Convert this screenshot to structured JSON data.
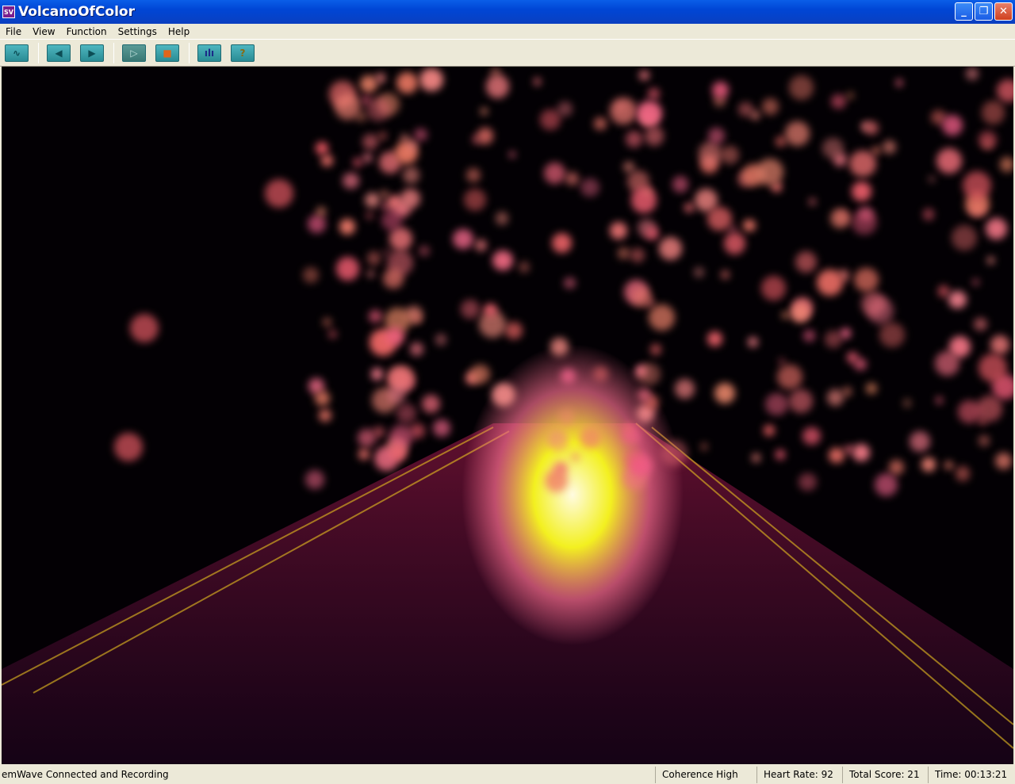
{
  "window": {
    "title": "VolcanoOfColor",
    "icon_text": "SV"
  },
  "menu": [
    "File",
    "View",
    "Function",
    "Settings",
    "Help"
  ],
  "toolbar": [
    {
      "name": "waveform-button",
      "glyph": "∿"
    },
    {
      "name": "previous-button",
      "glyph": "◀"
    },
    {
      "name": "next-button",
      "glyph": "▶"
    },
    {
      "name": "play-button",
      "glyph": "▷"
    },
    {
      "name": "stop-button",
      "glyph": "■"
    },
    {
      "name": "chart-button",
      "glyph": "ılı"
    },
    {
      "name": "help-button",
      "glyph": "?"
    }
  ],
  "status": {
    "connection": "emWave Connected and Recording",
    "coherence": "Coherence High",
    "heart_rate": "Heart Rate: 92",
    "total_score": "Total Score: 21",
    "time": "Time: 00:13:21"
  }
}
